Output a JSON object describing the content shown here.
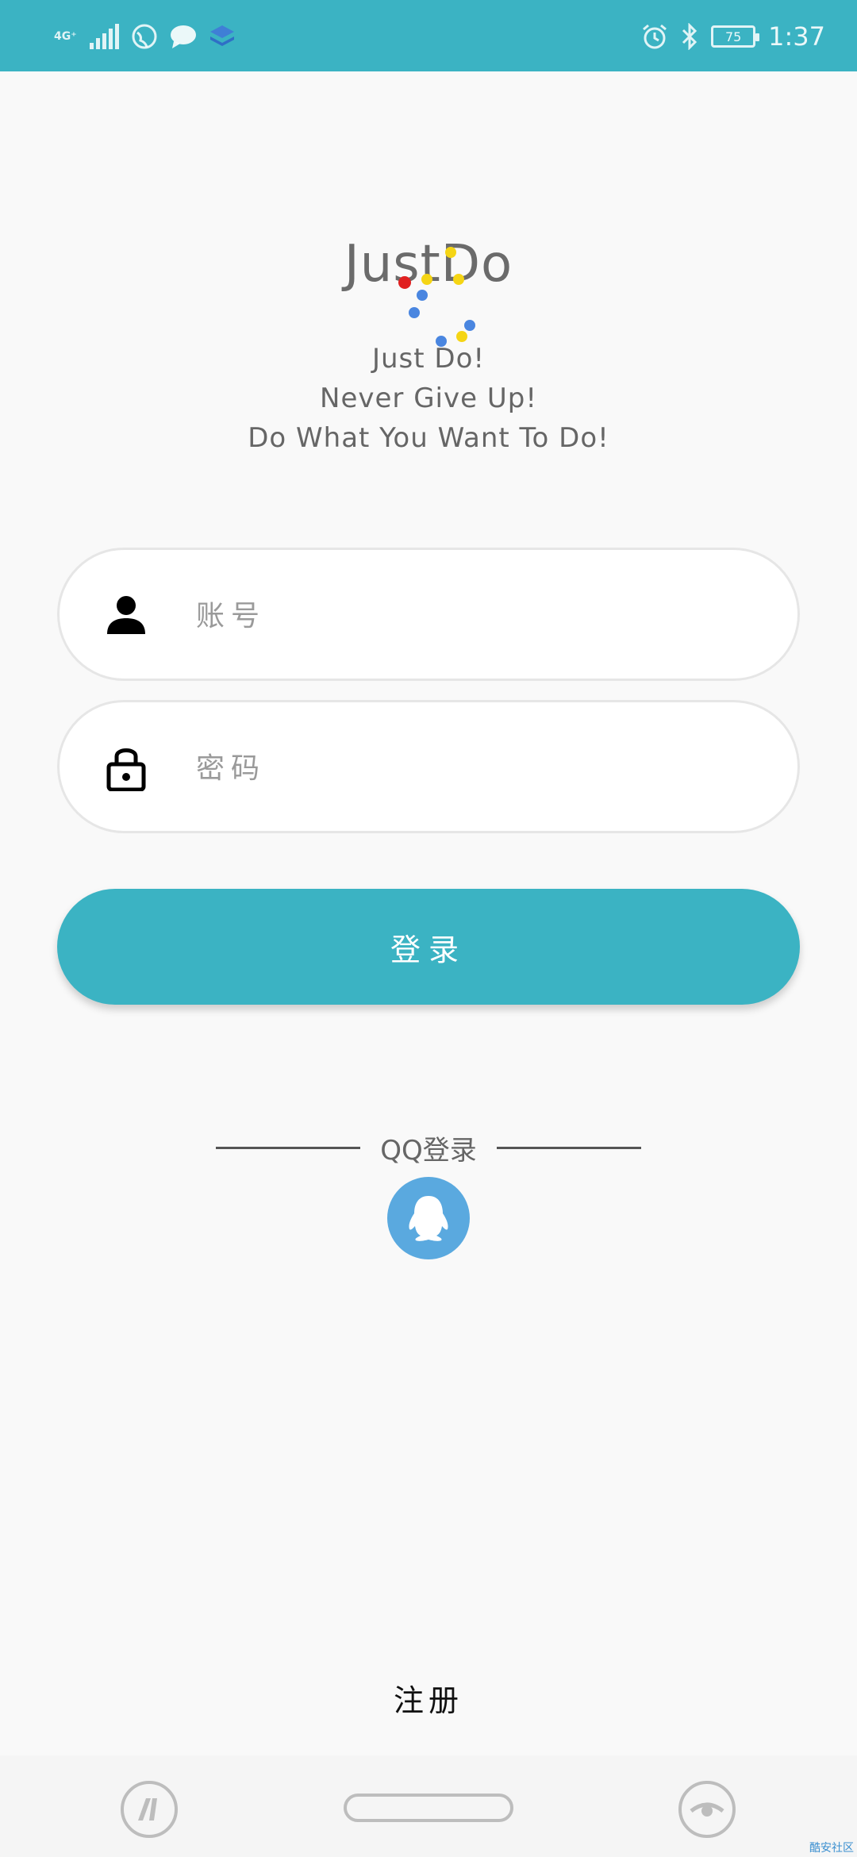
{
  "status_bar": {
    "network_label": "4G⁺",
    "time": "1:37",
    "battery": "75"
  },
  "logo": {
    "title": "JustDo"
  },
  "taglines": [
    "Just Do!",
    "Never Give Up!",
    "Do What You Want To Do!"
  ],
  "form": {
    "account_placeholder": "账号",
    "password_placeholder": "密码",
    "login_label": "登录"
  },
  "qq_login": {
    "label": "QQ登录"
  },
  "register_label": "注册",
  "watermark": "酷安社区",
  "colors": {
    "accent": "#3bb3c3",
    "qq_blue": "#5aa9df"
  },
  "icons": {
    "account": "person-icon",
    "password": "lock-icon",
    "qq": "qq-penguin-icon"
  }
}
